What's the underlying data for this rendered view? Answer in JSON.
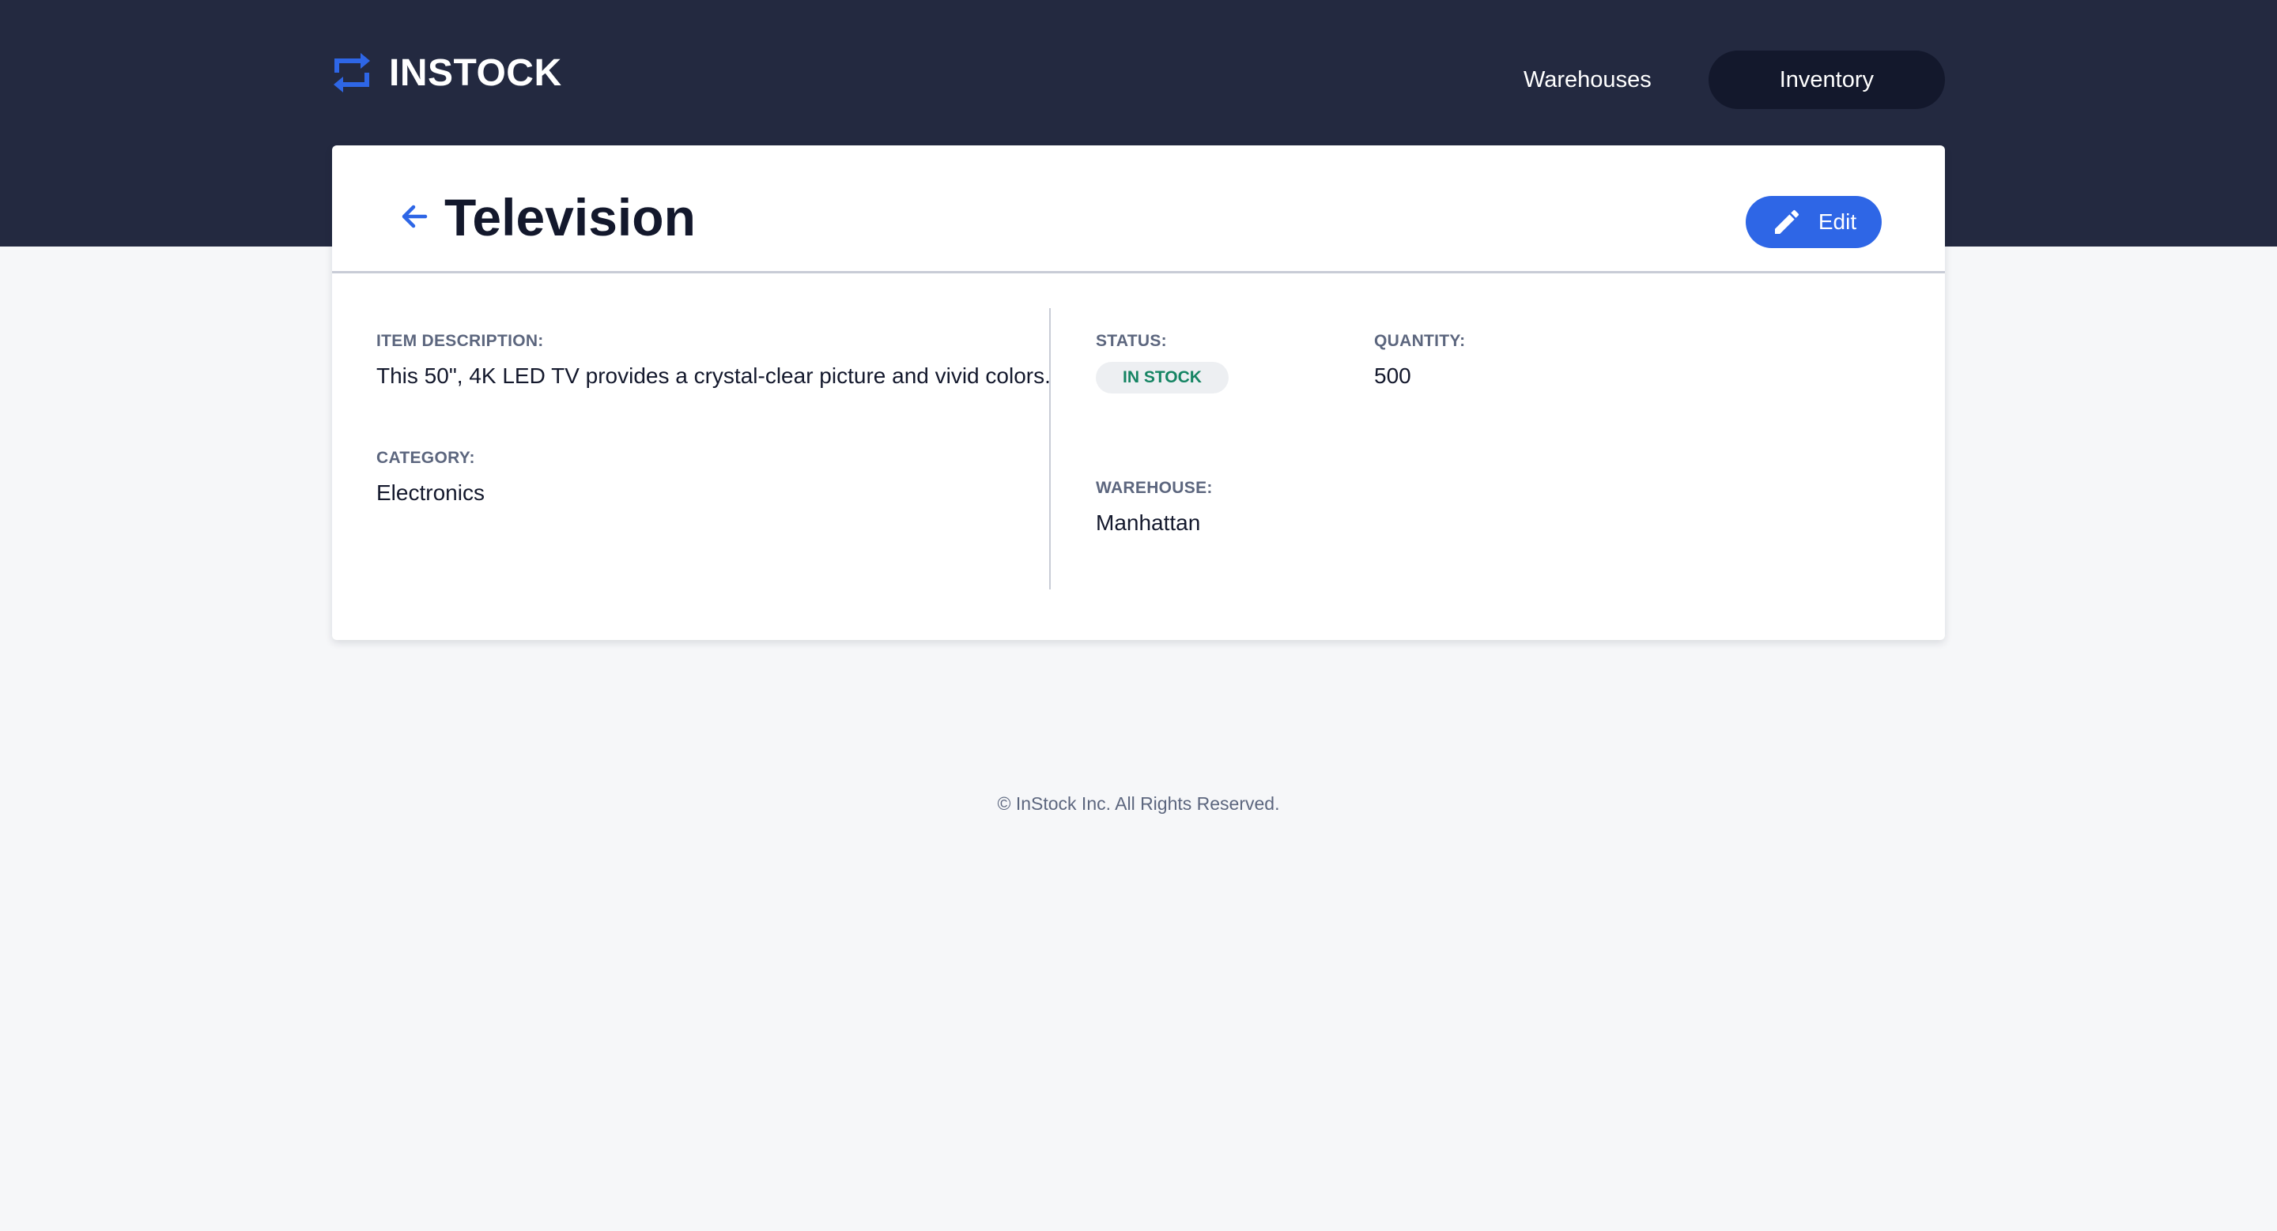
{
  "brand": {
    "name": "INSTOCK",
    "accent": "#2e66e6",
    "header_bg": "#232940"
  },
  "nav": {
    "items": [
      {
        "label": "Warehouses",
        "active": false
      },
      {
        "label": "Inventory",
        "active": true
      }
    ]
  },
  "item": {
    "title": "Television",
    "edit_label": "Edit",
    "description_label": "ITEM DESCRIPTION:",
    "description": "This 50\", 4K LED TV provides a crystal-clear picture and vivid colors.",
    "category_label": "CATEGORY:",
    "category": "Electronics",
    "status_label": "STATUS:",
    "status": "IN STOCK",
    "status_color": "#158463",
    "quantity_label": "QUANTITY:",
    "quantity": "500",
    "warehouse_label": "WAREHOUSE:",
    "warehouse": "Manhattan"
  },
  "icons": {
    "logo": "swap-arrows-icon",
    "back": "arrow-back-icon",
    "edit": "pencil-icon"
  },
  "footer": {
    "text": "© InStock Inc. All Rights Reserved."
  }
}
